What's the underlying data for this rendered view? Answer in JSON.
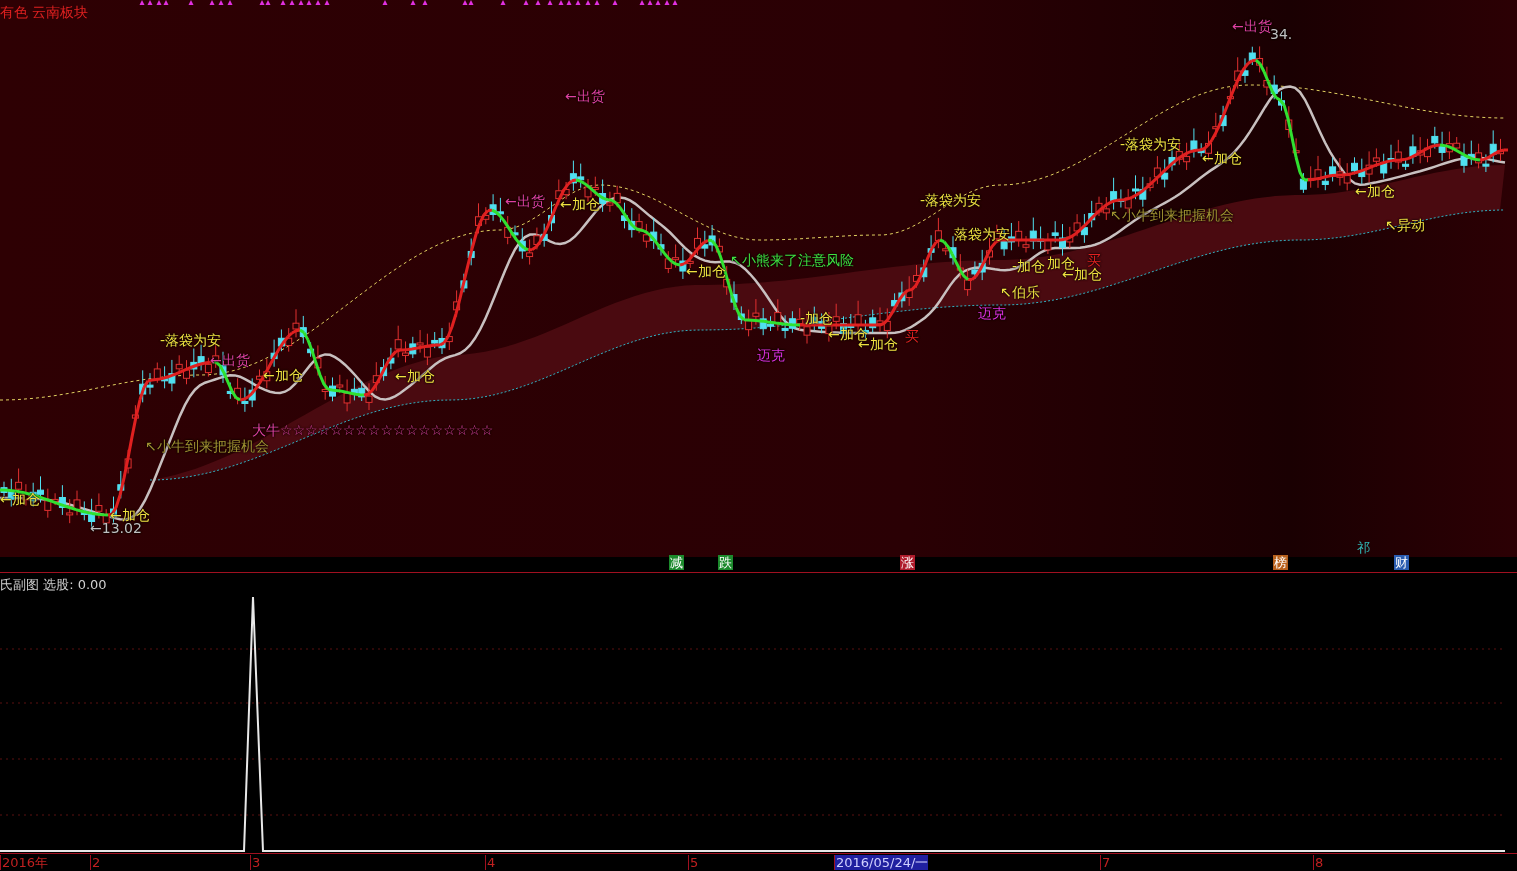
{
  "header": {
    "title": "有色 云南板块"
  },
  "annotations": [
    {
      "text": "←出货",
      "kind": "sell"
    },
    {
      "text": "34.",
      "kind": "price"
    },
    {
      "text": "←出货",
      "kind": "sell"
    },
    {
      "text": "-落袋为安",
      "kind": "add"
    },
    {
      "text": "←加仓",
      "kind": "add"
    },
    {
      "text": "←出货",
      "kind": "sell"
    },
    {
      "text": "←加仓",
      "kind": "add"
    },
    {
      "text": "-落袋为安",
      "kind": "add"
    },
    {
      "text": "←加仓",
      "kind": "add"
    },
    {
      "text": "↖小牛到来把握机会",
      "kind": "bull"
    },
    {
      "text": "落袋为安",
      "kind": "add"
    },
    {
      "text": "↖异动",
      "kind": "add"
    },
    {
      "text": "←加仓",
      "kind": "add"
    },
    {
      "text": "↖小熊来了注意风险",
      "kind": "bear"
    },
    {
      "text": "-加仓",
      "kind": "add"
    },
    {
      "text": "加仓",
      "kind": "add"
    },
    {
      "text": "←加仓",
      "kind": "add"
    },
    {
      "text": "买",
      "kind": "buy"
    },
    {
      "text": "↖伯乐",
      "kind": "add"
    },
    {
      "text": "-加仓",
      "kind": "add"
    },
    {
      "text": "迈克",
      "kind": "mike"
    },
    {
      "text": "-落袋为安",
      "kind": "add"
    },
    {
      "text": "←出货",
      "kind": "sell"
    },
    {
      "text": "迈克",
      "kind": "mike"
    },
    {
      "text": "←加仓",
      "kind": "add"
    },
    {
      "text": "←加仓",
      "kind": "add"
    },
    {
      "text": "买",
      "kind": "buy"
    },
    {
      "text": "←加仓",
      "kind": "add"
    },
    {
      "text": "←加仓",
      "kind": "add"
    },
    {
      "text": "大牛☆☆☆☆☆☆☆☆☆☆☆☆☆☆☆☆☆",
      "kind": "sell"
    },
    {
      "text": "↖小牛到来把握机会",
      "kind": "bull"
    },
    {
      "text": "←加仓",
      "kind": "add"
    },
    {
      "text": "←加仓",
      "kind": "add"
    },
    {
      "text": "←13.02",
      "kind": "price"
    }
  ],
  "markers": [
    {
      "text": "减",
      "kind": "tag",
      "color": "#1c8a2c"
    },
    {
      "text": "跌",
      "kind": "tag",
      "color": "#1c8a2c"
    },
    {
      "text": "涨",
      "kind": "tag",
      "color": "#b01c2c"
    },
    {
      "text": "榜",
      "kind": "tag",
      "color": "#b8601c"
    },
    {
      "text": "祁",
      "kind": "text",
      "color": "#30b0b0"
    },
    {
      "text": "财",
      "kind": "tag",
      "color": "#2a5cb0"
    }
  ],
  "subchart": {
    "title": "氏副图 选股: 0.00"
  },
  "axis": {
    "labels": [
      {
        "text": "2016年",
        "selected": false
      },
      {
        "text": "2",
        "selected": false
      },
      {
        "text": "3",
        "selected": false
      },
      {
        "text": "4",
        "selected": false
      },
      {
        "text": "5",
        "selected": false
      },
      {
        "text": "2016/05/24/一",
        "selected": true
      },
      {
        "text": "7",
        "selected": false
      },
      {
        "text": "8",
        "selected": false
      }
    ]
  }
}
